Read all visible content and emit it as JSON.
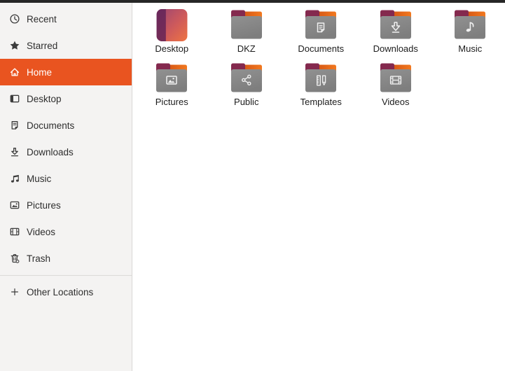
{
  "window": {
    "app": "Files",
    "top_edge_color": "#262626"
  },
  "colors": {
    "accent_orange": "#E95420",
    "sidebar_bg": "#F4F3F2",
    "content_bg": "#FFFFFF",
    "folder_body_gray": "#888888",
    "folder_tab_maroon": "#84294E",
    "folder_flap_orange": "#ED6C1A",
    "desktop_icon_purple": "#5E2156",
    "desktop_icon_gradient_end": "#EE7442",
    "sidebar_text": "#2E2E2E",
    "selected_text": "#FFFFFF"
  },
  "sidebar": {
    "items": [
      {
        "label": "Recent",
        "icon": "recent-clock-icon",
        "selected": false
      },
      {
        "label": "Starred",
        "icon": "star-icon",
        "selected": false
      },
      {
        "label": "Home",
        "icon": "home-icon",
        "selected": true
      },
      {
        "label": "Desktop",
        "icon": "desktop-icon",
        "selected": false
      },
      {
        "label": "Documents",
        "icon": "document-icon",
        "selected": false
      },
      {
        "label": "Downloads",
        "icon": "download-icon",
        "selected": false
      },
      {
        "label": "Music",
        "icon": "music-note-icon",
        "selected": false
      },
      {
        "label": "Pictures",
        "icon": "picture-icon",
        "selected": false
      },
      {
        "label": "Videos",
        "icon": "film-icon",
        "selected": false
      },
      {
        "label": "Trash",
        "icon": "trash-icon",
        "selected": false
      }
    ],
    "footer_item": {
      "label": "Other Locations",
      "icon": "plus-icon"
    }
  },
  "files": {
    "view": "icon-grid",
    "items": [
      {
        "name": "Desktop",
        "icon": "desktop-gradient-icon"
      },
      {
        "name": "DKZ",
        "icon": "folder-plain-icon"
      },
      {
        "name": "Documents",
        "icon": "folder-documents-icon"
      },
      {
        "name": "Downloads",
        "icon": "folder-downloads-icon"
      },
      {
        "name": "Music",
        "icon": "folder-music-icon"
      },
      {
        "name": "Pictures",
        "icon": "folder-pictures-icon"
      },
      {
        "name": "Public",
        "icon": "folder-public-icon"
      },
      {
        "name": "Templates",
        "icon": "folder-templates-icon"
      },
      {
        "name": "Videos",
        "icon": "folder-videos-icon"
      }
    ]
  }
}
